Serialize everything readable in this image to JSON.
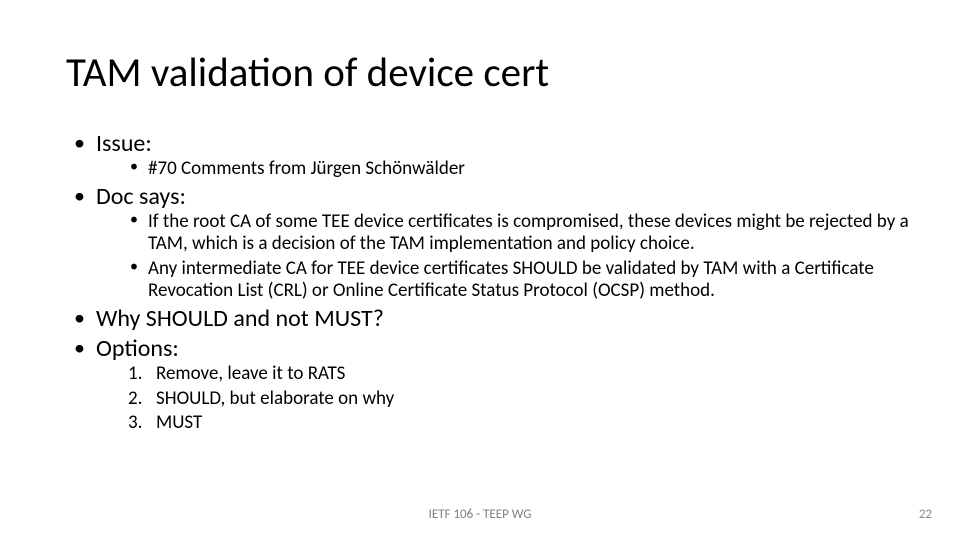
{
  "slide": {
    "title": "TAM validation of device cert",
    "bullets": {
      "issue": {
        "label": "Issue:",
        "items": [
          "#70 Comments from Jürgen Schönwälder"
        ]
      },
      "doc_says": {
        "label": "Doc says:",
        "items": [
          "If the root CA of some TEE device certificates is compromised, these devices might be rejected by a TAM, which is a decision of the TAM implementation and policy choice.",
          "Any intermediate CA for TEE device certificates SHOULD be validated by TAM with a Certificate Revocation List (CRL) or Online Certificate Status Protocol (OCSP) method."
        ]
      },
      "why": {
        "label": "Why SHOULD and not MUST?"
      },
      "options": {
        "label": "Options:",
        "items": [
          "Remove, leave it to RATS",
          "SHOULD, but elaborate on why",
          "MUST"
        ]
      }
    },
    "footer": "IETF 106 - TEEP WG",
    "page_number": "22"
  }
}
